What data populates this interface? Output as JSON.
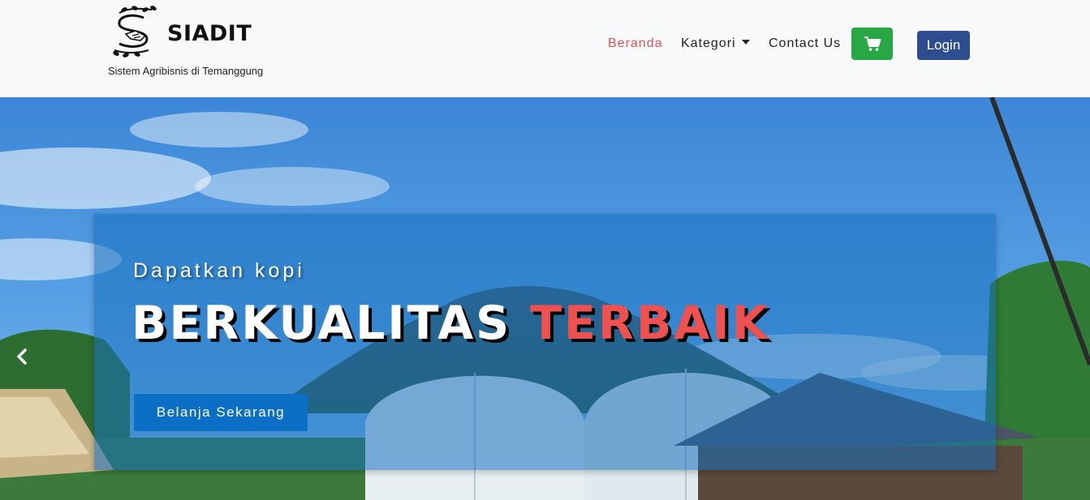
{
  "brand": {
    "name": "SIADIT",
    "tagline": "Sistem Agribisnis di Temanggung",
    "logo_icon": "handshake-leaf-logo"
  },
  "nav": {
    "items": [
      {
        "label": "Beranda",
        "active": true
      },
      {
        "label": "Kategori",
        "dropdown": true
      },
      {
        "label": "Contact Us"
      }
    ],
    "cart_icon": "shopping-cart-icon",
    "login_label": "Login"
  },
  "hero": {
    "subtitle": "Dapatkan kopi",
    "title_part1": "BERKUALITAS",
    "title_part2": "TERBAIK",
    "cta_label": "Belanja Sekarang",
    "prev_icon": "chevron-left-icon"
  },
  "colors": {
    "navbar_bg": "#f8f9fa",
    "active_link": "#e25454",
    "cart_button": "#28a745",
    "login_button": "#2e4d8f",
    "cta_button": "#0b6fc6",
    "title_accent": "#ef5050",
    "caption_overlay": "#166fbe"
  }
}
